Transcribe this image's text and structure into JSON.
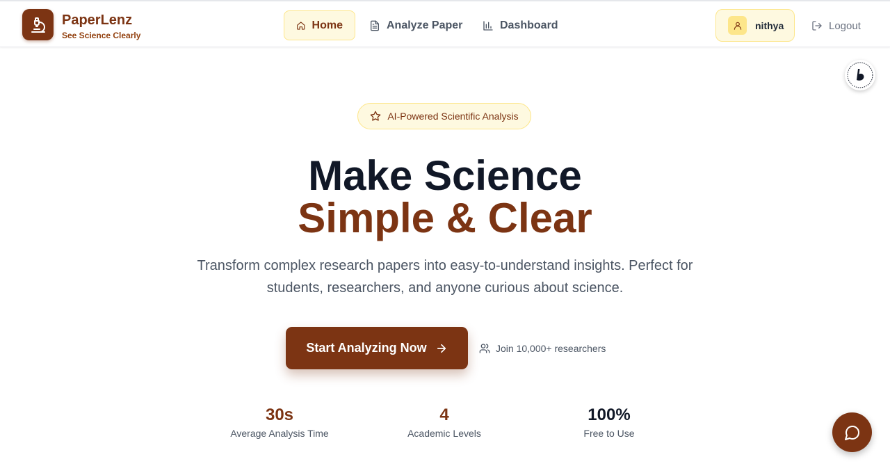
{
  "brand": {
    "name": "PaperLenz",
    "tagline": "See Science Clearly",
    "logo_icon": "microscope-icon"
  },
  "nav": {
    "items": [
      {
        "label": "Home",
        "icon": "home-icon",
        "active": true
      },
      {
        "label": "Analyze Paper",
        "icon": "file-text-icon",
        "active": false
      },
      {
        "label": "Dashboard",
        "icon": "bar-chart-icon",
        "active": false
      }
    ]
  },
  "user": {
    "name": "nithya",
    "icon": "user-icon"
  },
  "logout": {
    "label": "Logout",
    "icon": "log-out-icon"
  },
  "hero": {
    "badge": "AI-Powered Scientific Analysis",
    "badge_icon": "star-icon",
    "title_line1": "Make Science",
    "title_line2": "Simple & Clear",
    "description": "Transform complex research papers into easy-to-understand insights. Perfect for students, researchers, and anyone curious about science.",
    "cta_label": "Start Analyzing Now",
    "cta_icon": "arrow-right-icon",
    "join_text": "Join 10,000+ researchers",
    "join_icon": "users-icon"
  },
  "stats": [
    {
      "value": "30s",
      "label": "Average Analysis Time",
      "color": "#7c3413"
    },
    {
      "value": "4",
      "label": "Academic Levels",
      "color": "#7c3413"
    },
    {
      "value": "100%",
      "label": "Free to Use",
      "color": "#111827"
    }
  ],
  "colors": {
    "brand": "#7c3413",
    "accent_bg": "#fef9e0",
    "accent_border": "#fde68a",
    "text_dark": "#111827",
    "text_muted": "#4b5563"
  }
}
